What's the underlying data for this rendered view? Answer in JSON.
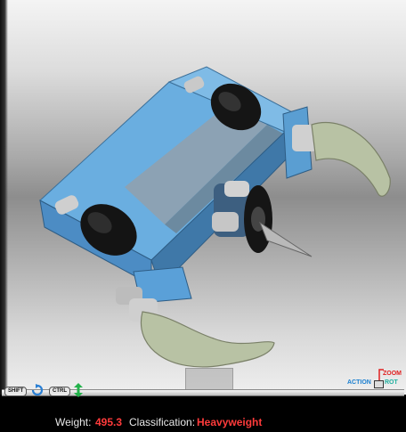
{
  "status": {
    "weight_label": "Weight:",
    "weight_value": "495.3",
    "classification_label": "Classification:",
    "classification_value": "Heavyweight"
  },
  "controls": {
    "shift_key": "SHIFT",
    "ctrl_key": "CTRL",
    "zoom_label": "ZOOM",
    "action_label": "ACTION",
    "rot_label": "ROT"
  },
  "icons": {
    "rotate": "rotate-icon",
    "move": "move-vertical-icon"
  },
  "colors": {
    "robot_body": "#5aa0d8",
    "robot_top_panel": "#8fa5b8",
    "claw": "#b8c2a4",
    "status_value": "#ff3b3b",
    "zoom": "#e02020",
    "action": "#1a7fd0",
    "rot": "#20b0a0"
  }
}
